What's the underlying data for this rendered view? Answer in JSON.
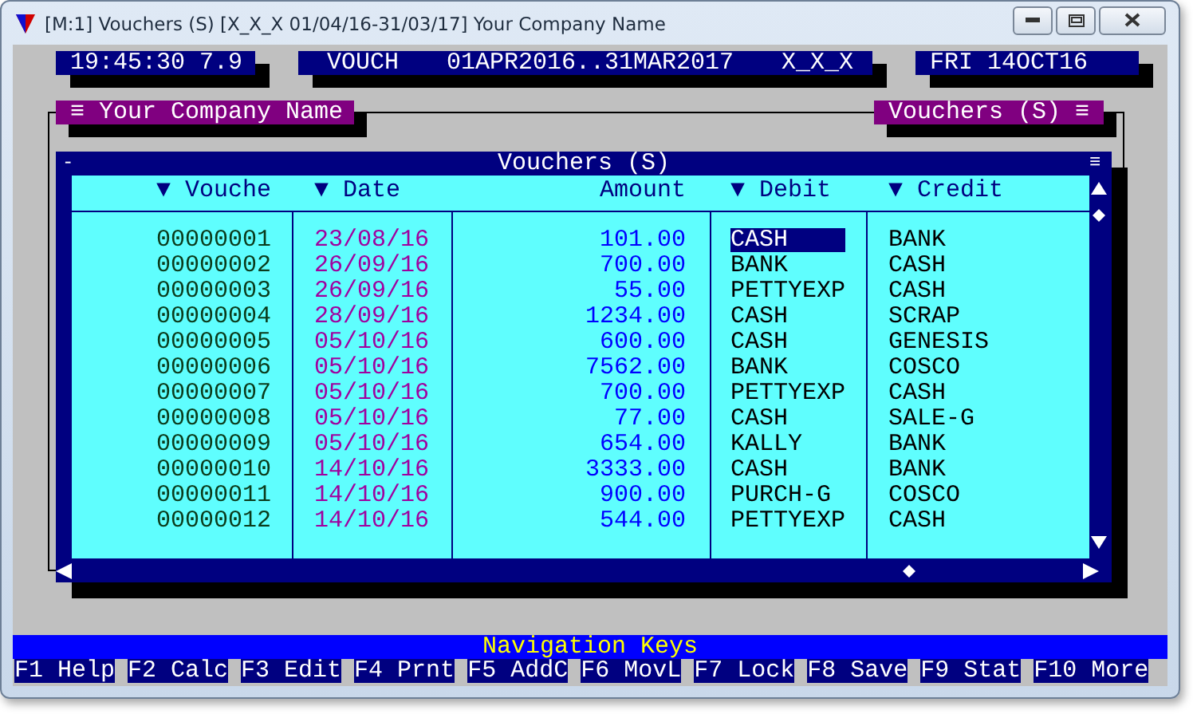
{
  "window": {
    "title": "[M:1]  Vouchers (S)  [X_X_X  01/04/16-31/03/17]  Your Company Name"
  },
  "status": {
    "clock": "19:45:30 7.9",
    "module": "VOUCH",
    "period": "01APR2016..31MAR2017",
    "user": "X_X_X",
    "date": "FRI 14OCT16"
  },
  "tabs": {
    "left": "≡ Your Company Name",
    "right": "Vouchers (S) ≡"
  },
  "table": {
    "title": "Vouchers (S)",
    "left_glyph": "-",
    "right_glyph": "≡",
    "columns": [
      "▼ Vouche",
      "▼ Date",
      "Amount",
      "▼ Debit",
      "▼ Credit"
    ],
    "rows": [
      {
        "voucher": "00000001",
        "date": "23/08/16",
        "amount": "101.00",
        "debit": "CASH",
        "credit": "BANK",
        "selected": true
      },
      {
        "voucher": "00000002",
        "date": "26/09/16",
        "amount": "700.00",
        "debit": "BANK",
        "credit": "CASH",
        "selected": false
      },
      {
        "voucher": "00000003",
        "date": "26/09/16",
        "amount": "55.00",
        "debit": "PETTYEXP",
        "credit": "CASH",
        "selected": false
      },
      {
        "voucher": "00000004",
        "date": "28/09/16",
        "amount": "1234.00",
        "debit": "CASH",
        "credit": "SCRAP",
        "selected": false
      },
      {
        "voucher": "00000005",
        "date": "05/10/16",
        "amount": "600.00",
        "debit": "CASH",
        "credit": "GENESIS",
        "selected": false
      },
      {
        "voucher": "00000006",
        "date": "05/10/16",
        "amount": "7562.00",
        "debit": "BANK",
        "credit": "COSCO",
        "selected": false
      },
      {
        "voucher": "00000007",
        "date": "05/10/16",
        "amount": "700.00",
        "debit": "PETTYEXP",
        "credit": "CASH",
        "selected": false
      },
      {
        "voucher": "00000008",
        "date": "05/10/16",
        "amount": "77.00",
        "debit": "CASH",
        "credit": "SALE-G",
        "selected": false
      },
      {
        "voucher": "00000009",
        "date": "05/10/16",
        "amount": "654.00",
        "debit": "KALLY",
        "credit": "BANK",
        "selected": false
      },
      {
        "voucher": "00000010",
        "date": "14/10/16",
        "amount": "3333.00",
        "debit": "CASH",
        "credit": "BANK",
        "selected": false
      },
      {
        "voucher": "00000011",
        "date": "14/10/16",
        "amount": "900.00",
        "debit": "PURCH-G",
        "credit": "COSCO",
        "selected": false
      },
      {
        "voucher": "00000012",
        "date": "14/10/16",
        "amount": "544.00",
        "debit": "PETTYEXP",
        "credit": "CASH",
        "selected": false
      }
    ]
  },
  "footer": {
    "title": "Navigation Keys",
    "keys": [
      {
        "key": "F1",
        "label": "Help"
      },
      {
        "key": "F2",
        "label": "Calc"
      },
      {
        "key": "F3",
        "label": "Edit"
      },
      {
        "key": "F4",
        "label": "Prnt"
      },
      {
        "key": "F5",
        "label": "AddC"
      },
      {
        "key": "F6",
        "label": "MovL"
      },
      {
        "key": "F7",
        "label": "Lock"
      },
      {
        "key": "F8",
        "label": "Save"
      },
      {
        "key": "F9",
        "label": "Stat"
      },
      {
        "key": "F10",
        "label": "More"
      }
    ]
  }
}
